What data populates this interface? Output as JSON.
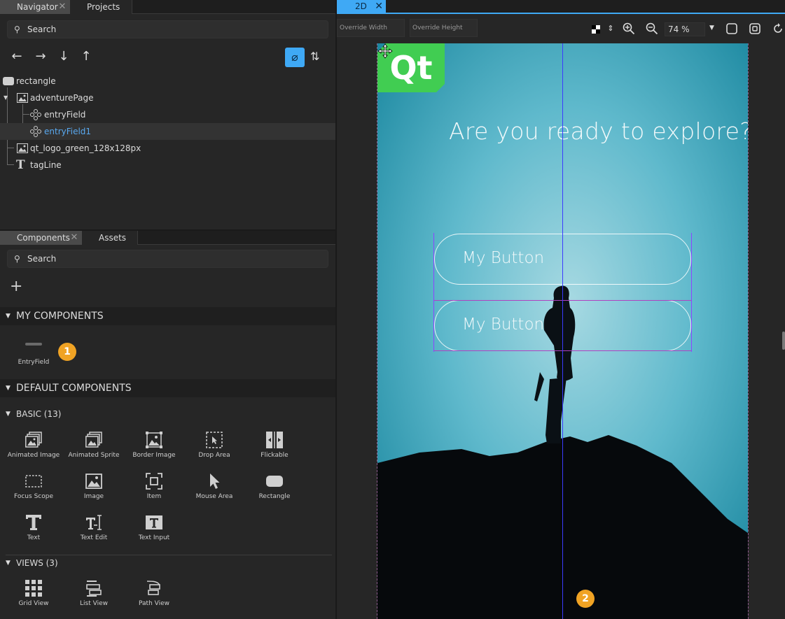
{
  "navigator": {
    "tabs": [
      {
        "label": "Navigator"
      },
      {
        "label": "Projects"
      }
    ],
    "search_placeholder": "Search",
    "tree": [
      {
        "label": "rectangle",
        "icon": "rectangle-icon"
      },
      {
        "label": "adventurePage",
        "icon": "image-icon"
      },
      {
        "label": "entryField",
        "icon": "component-icon"
      },
      {
        "label": "entryField1",
        "icon": "component-icon",
        "selected": true
      },
      {
        "label": "qt_logo_green_128x128px",
        "icon": "image-icon"
      },
      {
        "label": "tagLine",
        "icon": "text-icon"
      }
    ]
  },
  "components": {
    "tabs": [
      {
        "label": "Components"
      },
      {
        "label": "Assets"
      }
    ],
    "search_placeholder": "Search",
    "my_components": {
      "title": "MY COMPONENTS",
      "items": [
        {
          "label": "EntryField"
        }
      ]
    },
    "default_components": {
      "title": "DEFAULT COMPONENTS"
    },
    "basic": {
      "title": "BASIC (13)",
      "items": [
        {
          "label": "Animated Image",
          "icon": "animated-image-icon"
        },
        {
          "label": "Animated Sprite",
          "icon": "animated-sprite-icon"
        },
        {
          "label": "Border Image",
          "icon": "border-image-icon"
        },
        {
          "label": "Drop Area",
          "icon": "drop-area-icon"
        },
        {
          "label": "Flickable",
          "icon": "flickable-icon"
        },
        {
          "label": "Focus Scope",
          "icon": "focus-scope-icon"
        },
        {
          "label": "Image",
          "icon": "image-icon"
        },
        {
          "label": "Item",
          "icon": "item-icon"
        },
        {
          "label": "Mouse Area",
          "icon": "mouse-area-icon"
        },
        {
          "label": "Rectangle",
          "icon": "rectangle-icon"
        },
        {
          "label": "Text",
          "icon": "text-icon"
        },
        {
          "label": "Text Edit",
          "icon": "text-edit-icon"
        },
        {
          "label": "Text Input",
          "icon": "text-input-icon"
        }
      ]
    },
    "views": {
      "title": "VIEWS (3)",
      "items": [
        {
          "label": "Grid View",
          "icon": "grid-view-icon"
        },
        {
          "label": "List View",
          "icon": "list-view-icon"
        },
        {
          "label": "Path View",
          "icon": "path-view-icon"
        }
      ]
    }
  },
  "badges": {
    "one": "1",
    "two": "2"
  },
  "editor": {
    "tab_label": "2D",
    "override_width": "Override Width",
    "override_height": "Override Height",
    "zoom": "74 %"
  },
  "canvas": {
    "logo_text": "Qt",
    "heading": "Are you ready to explore?",
    "button_1": "My Button",
    "button_2": "My Button"
  },
  "colors": {
    "accent": "#3fa9f5",
    "qt_green": "#41cd52",
    "badge": "#f0a324"
  }
}
